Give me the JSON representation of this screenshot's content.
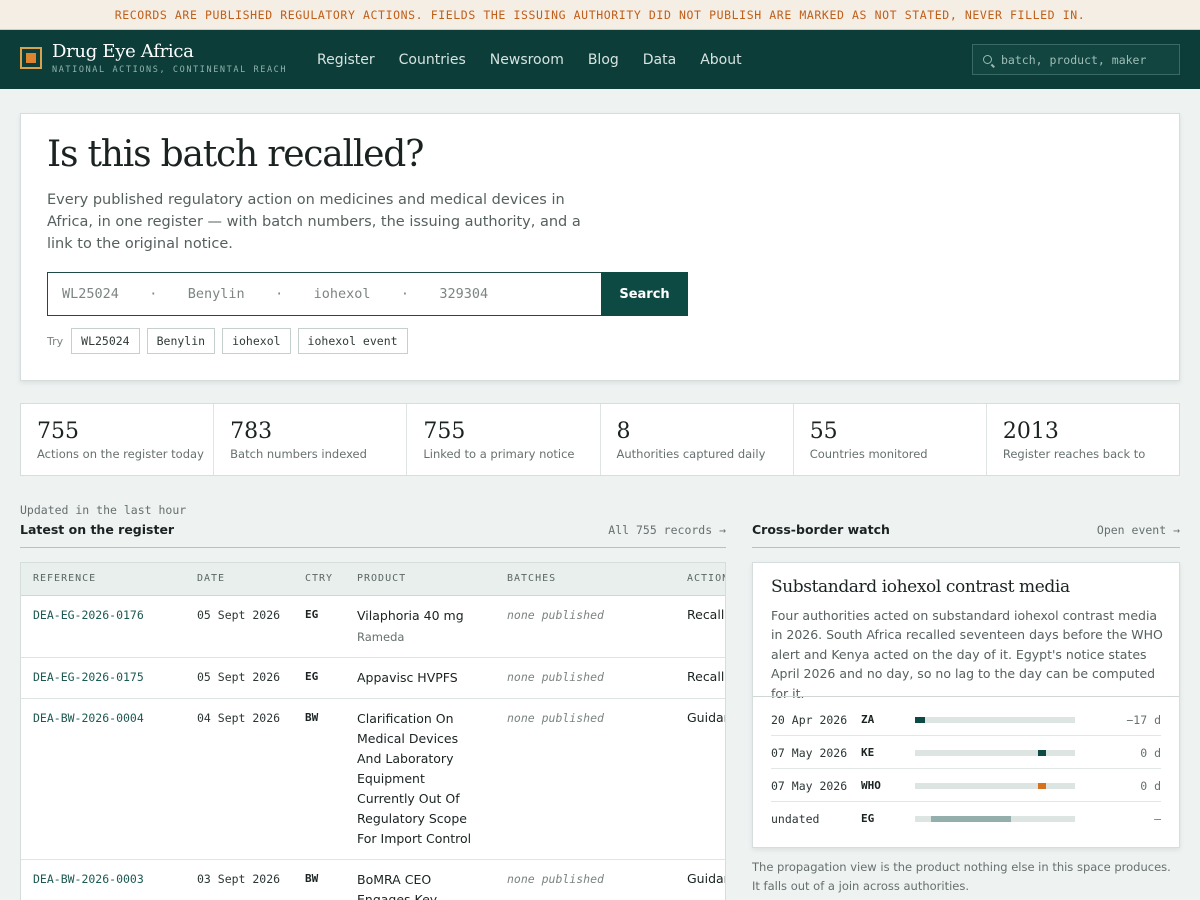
{
  "notice": "RECORDS ARE PUBLISHED REGULATORY ACTIONS. FIELDS THE ISSUING AUTHORITY DID NOT PUBLISH ARE MARKED AS NOT STATED, NEVER FILLED IN.",
  "header": {
    "brand_name": "Drug Eye Africa",
    "brand_tagline": "NATIONAL ACTIONS, CONTINENTAL REACH",
    "nav": [
      "Register",
      "Countries",
      "Newsroom",
      "Blog",
      "Data",
      "About"
    ],
    "search_placeholder": "batch, product, maker",
    "logo_icon": "square-logo-icon",
    "search_icon": "search-icon"
  },
  "hero": {
    "title": "Is this batch recalled?",
    "lead": "Every published regulatory action on medicines and medical devices in Africa, in one register — with batch numbers, the issuing authority, and a link to the original notice.",
    "search_placeholder": "WL25024   ·   Benylin   ·   iohexol   ·   329304",
    "search_button": "Search",
    "try_label": "Try",
    "try_chips": [
      "WL25024",
      "Benylin",
      "iohexol",
      "iohexol event"
    ]
  },
  "stats": [
    {
      "value": "755",
      "label": "Actions on the register today"
    },
    {
      "value": "783",
      "label": "Batch numbers indexed"
    },
    {
      "value": "755",
      "label": "Linked to a primary notice"
    },
    {
      "value": "8",
      "label": "Authorities captured daily"
    },
    {
      "value": "55",
      "label": "Countries monitored"
    },
    {
      "value": "2013",
      "label": "Register reaches back to"
    }
  ],
  "latest": {
    "updated": "Updated in the last hour",
    "title": "Latest on the register",
    "link": "All 755 records →",
    "columns": [
      "REFERENCE",
      "DATE",
      "CTRY",
      "PRODUCT",
      "BATCHES",
      "ACTION"
    ],
    "rows": [
      {
        "ref": "DEA-EG-2026-0176",
        "date": "05 Sept 2026",
        "ctry": "EG",
        "product": "Vilaphoria 40 mg",
        "maker": "Rameda",
        "batches": "none published",
        "action": "Recall"
      },
      {
        "ref": "DEA-EG-2026-0175",
        "date": "05 Sept 2026",
        "ctry": "EG",
        "product": "Appavisc HVPFS",
        "maker": "",
        "batches": "none published",
        "action": "Recall"
      },
      {
        "ref": "DEA-BW-2026-0004",
        "date": "04 Sept 2026",
        "ctry": "BW",
        "product": "Clarification On Medical Devices And Laboratory Equipment Currently Out Of Regulatory Scope For Import Control",
        "maker": "",
        "batches": "none published",
        "action": "Guidance"
      },
      {
        "ref": "DEA-BW-2026-0003",
        "date": "03 Sept 2026",
        "ctry": "BW",
        "product": "BoMRA CEO Engages Key Veterinary",
        "maker": "",
        "batches": "none published",
        "action": "Guidance"
      }
    ]
  },
  "watch": {
    "title": "Cross-border watch",
    "link": "Open event →",
    "event_title": "Substandard iohexol contrast media",
    "event_text": "Four authorities acted on substandard iohexol contrast media in 2026. South Africa recalled seventeen days before the WHO alert and Kenya acted on the day of it. Egypt's notice states April 2026 and no day, so no lag to the day can be computed for it.",
    "timeline": [
      {
        "date": "20 Apr 2026",
        "ctry": "ZA",
        "lag": "−17 d",
        "pos_start": 0.0,
        "pos_end": 0.06,
        "color": "#0d4a44"
      },
      {
        "date": "07 May 2026",
        "ctry": "KE",
        "lag": "0 d",
        "pos_start": 0.77,
        "pos_end": 0.82,
        "color": "#0d4a44"
      },
      {
        "date": "07 May 2026",
        "ctry": "WHO",
        "lag": "0 d",
        "pos_start": 0.77,
        "pos_end": 0.82,
        "color": "#d6711e"
      },
      {
        "date": "undated",
        "ctry": "EG",
        "lag": "—",
        "pos_start": 0.1,
        "pos_end": 0.6,
        "color": "#93aeab"
      }
    ],
    "footnote": "The propagation view is the product nothing else in this space produces. It falls out of a join across authorities."
  }
}
